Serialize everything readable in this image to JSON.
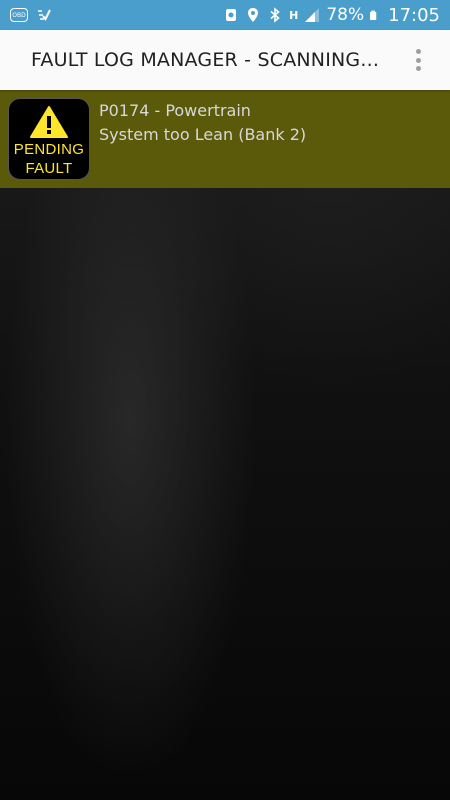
{
  "status_bar": {
    "obd_label": "OBD",
    "battery_percent": "78%",
    "time": "17:05",
    "network_label": "H",
    "icons": [
      "obd-icon",
      "checkmark-icon",
      "sync-icon",
      "location-icon",
      "bluetooth-icon",
      "network-h-icon",
      "signal-icon",
      "battery-icon"
    ]
  },
  "app_bar": {
    "title": "FAULT LOG MANAGER - SCANNING...",
    "menu_icon": "overflow-menu-icon"
  },
  "faults": [
    {
      "badge": {
        "line1": "PENDING",
        "line2": "FAULT",
        "icon": "warning-icon"
      },
      "code_line": "P0174 - Powertrain",
      "description": "System too Lean (Bank 2)"
    }
  ],
  "colors": {
    "status_bar": "#4a9ecb",
    "app_bar": "#fafafa",
    "fault_row": "#5a5a0a",
    "badge_text": "#ffe52b",
    "warning_yellow": "#ffe52b"
  }
}
